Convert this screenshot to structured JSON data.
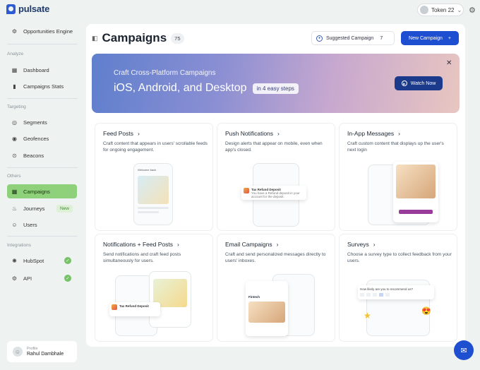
{
  "app": {
    "brand": "pulsate"
  },
  "topbar": {
    "token_label": "Token 22",
    "token_caret": "⌄"
  },
  "sidebar": {
    "top_item": {
      "label": "Opportunities Engine",
      "icon": "gear-icon"
    },
    "sections": {
      "analyze": "Analyze",
      "targeting": "Targeting",
      "others": "Others",
      "integrations": "Integrations"
    },
    "analyze_items": [
      {
        "label": "Dashboard",
        "icon": "grid-icon"
      },
      {
        "label": "Campaigns Stats",
        "icon": "bar-chart-icon"
      }
    ],
    "targeting_items": [
      {
        "label": "Segments",
        "icon": "segments-icon"
      },
      {
        "label": "Geofences",
        "icon": "geofence-icon"
      },
      {
        "label": "Beacons",
        "icon": "beacon-icon"
      }
    ],
    "others_items": [
      {
        "label": "Campaigns",
        "icon": "grid-icon",
        "active": true
      },
      {
        "label": "Journeys",
        "icon": "journey-icon",
        "badge": "New"
      },
      {
        "label": "Users",
        "icon": "users-icon"
      }
    ],
    "integration_items": [
      {
        "label": "HubSpot",
        "icon": "hubspot-icon",
        "connected": true
      },
      {
        "label": "API",
        "icon": "gear-icon",
        "connected": true
      }
    ],
    "profile": {
      "label": "Profile",
      "name": "Rahul Dambhale"
    }
  },
  "header": {
    "title": "Campaigns",
    "count": "75",
    "suggested_label": "Suggested Campaign",
    "suggested_count": "7",
    "new_button": "New Campaign",
    "new_button_icon": "+"
  },
  "banner": {
    "subtitle": "Craft Cross-Platform Campaigns",
    "headline": "iOS, Android, and Desktop",
    "steps": "in 4 easy steps",
    "watch_button": "Watch Now",
    "close": "✕",
    "gradient": [
      "#5f7fcd",
      "#e8c6c0"
    ]
  },
  "cards": [
    {
      "title": "Feed Posts",
      "desc": "Craft content that appears in users' scrollable feeds for ongoing engagement."
    },
    {
      "title": "Push Notifications",
      "desc": "Design alerts that appear on mobile, even when app's closed."
    },
    {
      "title": "In-App Messages",
      "desc": "Craft custom content that displays up the user's next login"
    },
    {
      "title": "Notifications + Feed Posts",
      "desc": "Send notifications and craft feed posts simultaneously for users."
    },
    {
      "title": "Email Campaigns",
      "desc": "Craft and send personalized messages directly to users' inboxes."
    },
    {
      "title": "Surveys",
      "desc": "Choose a survey type to collect feedback from your users."
    }
  ],
  "illustrations": {
    "notif_title": "Tax Refund Deposit",
    "notif_time": "2 min ago",
    "notif_body": "You have a Refund deposit in your account for the deposit.",
    "feed_likes": "Welcome back",
    "email_label": "Fintech",
    "survey_question": "How likely are you to recommend us?"
  },
  "colors": {
    "accent": "#1f4fd1",
    "active_nav": "#8fd17b",
    "check": "#76c267"
  }
}
